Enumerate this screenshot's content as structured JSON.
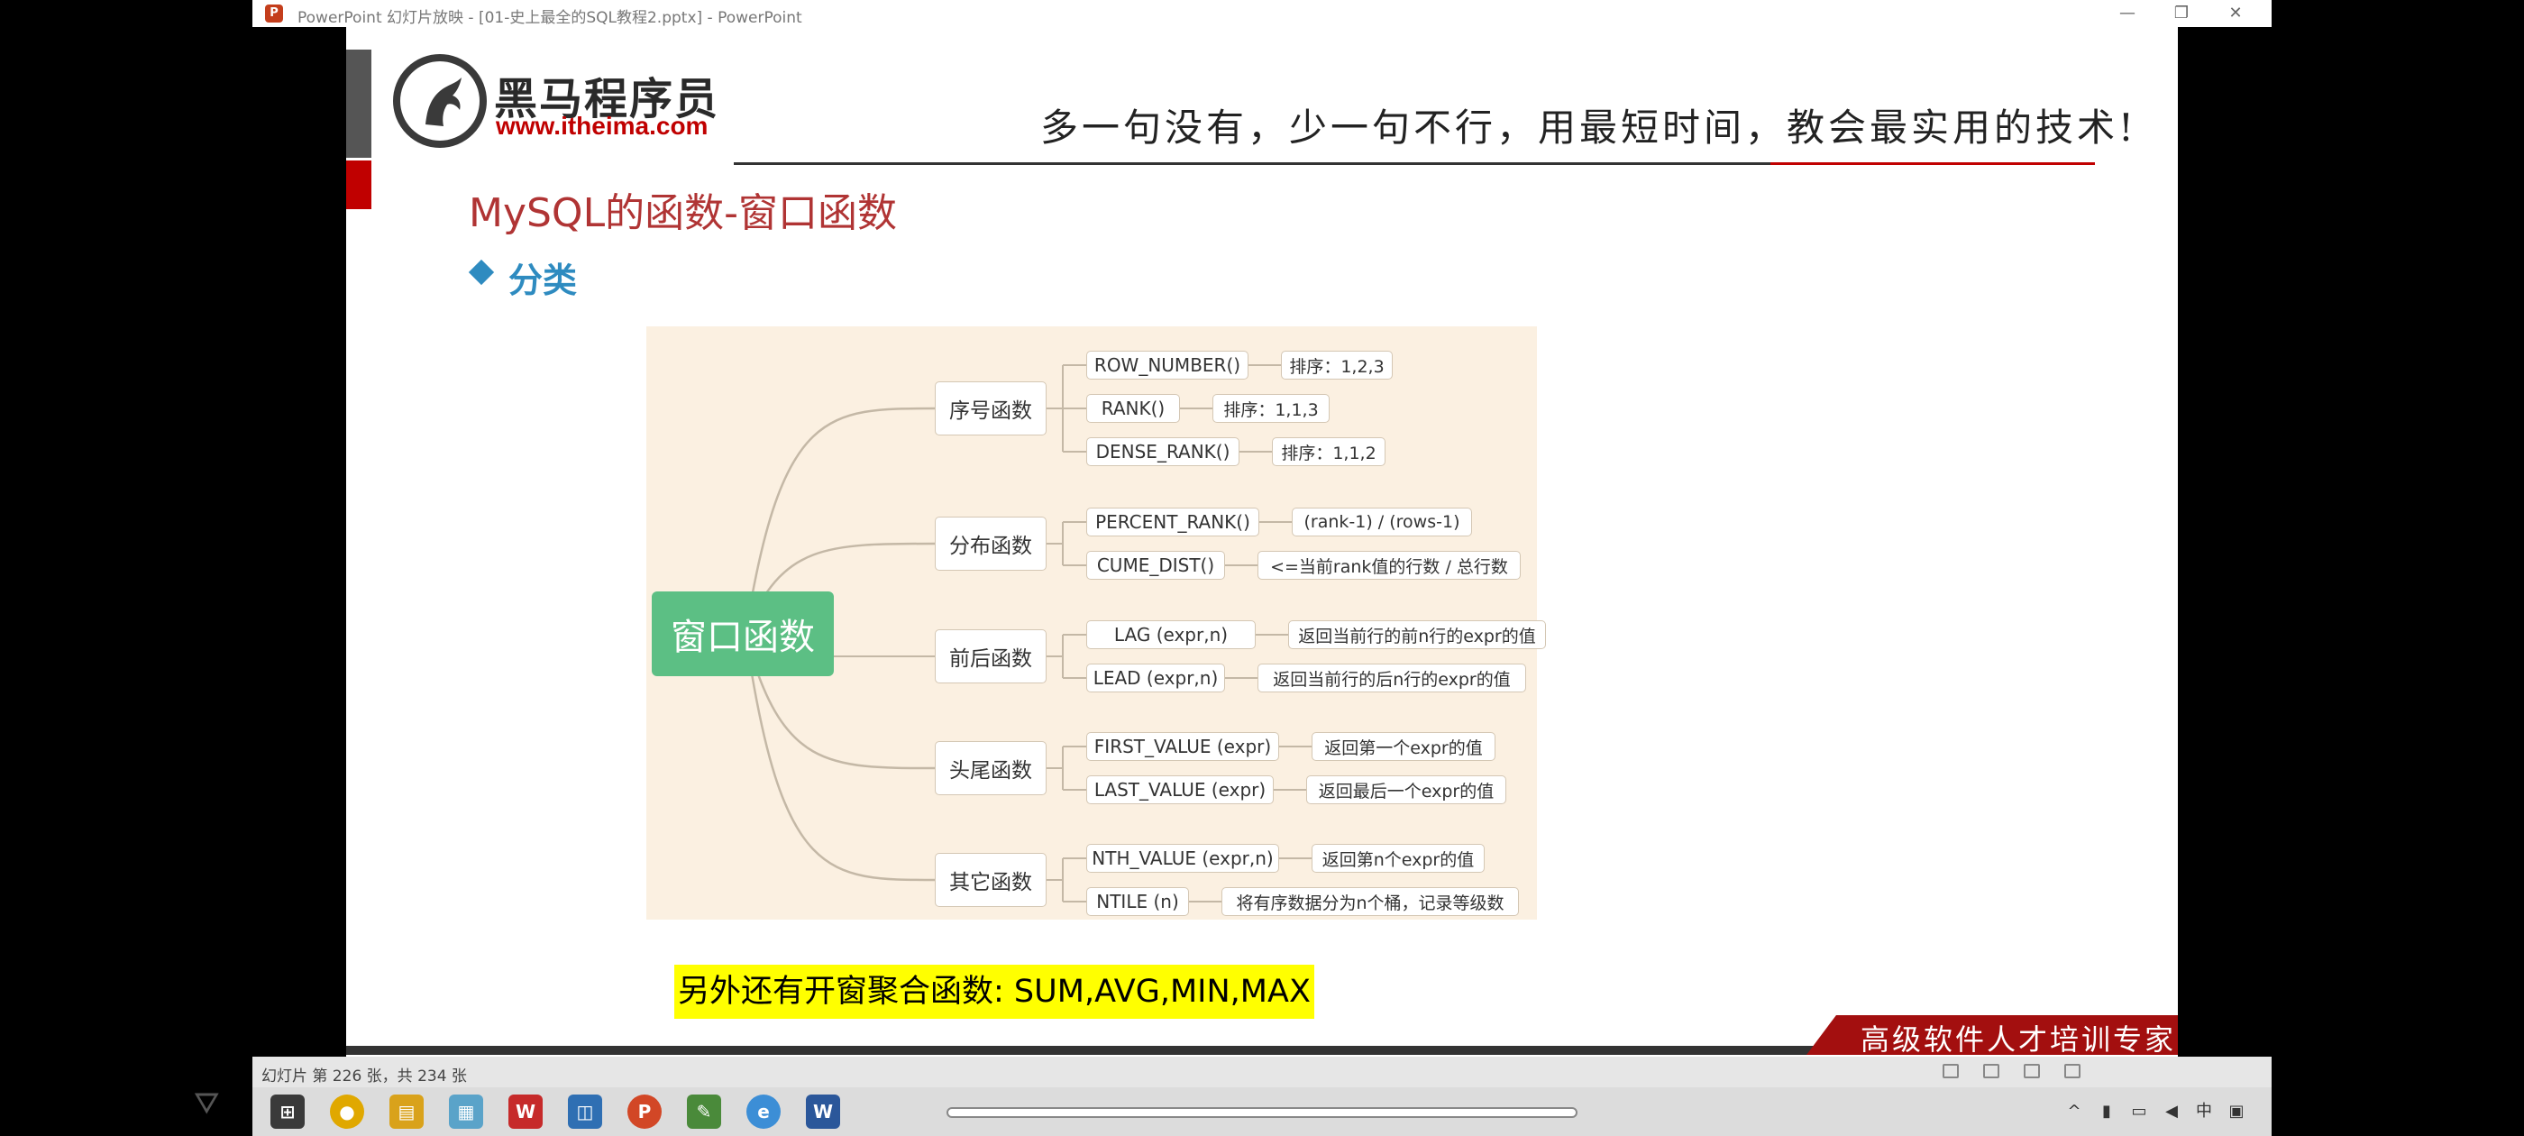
{
  "window": {
    "title": "PowerPoint 幻灯片放映 - [01-史上最全的SQL教程2.pptx] - PowerPoint",
    "app_icon": "P",
    "minimize": "—",
    "maximize": "❐",
    "close": "✕"
  },
  "slide": {
    "logo_name": "黑马程序员",
    "logo_url": "www.itheima.com",
    "slogan": "多一句没有，少一句不行，用最短时间，教会最实用的技术!",
    "title": "MySQL的函数-窗口函数",
    "bullet": "分类",
    "mindmap": {
      "root": "窗口函数",
      "categories": [
        {
          "label": "序号函数",
          "items": [
            {
              "name": "ROW_NUMBER()",
              "desc": "排序：1,2,3"
            },
            {
              "name": "RANK()",
              "desc": "排序：1,1,3"
            },
            {
              "name": "DENSE_RANK()",
              "desc": "排序：1,1,2"
            }
          ]
        },
        {
          "label": "分布函数",
          "items": [
            {
              "name": "PERCENT_RANK()",
              "desc": "(rank-1) / (rows-1)"
            },
            {
              "name": "CUME_DIST()",
              "desc": "<=当前rank值的行数 / 总行数"
            }
          ]
        },
        {
          "label": "前后函数",
          "items": [
            {
              "name": "LAG (expr,n)",
              "desc": "返回当前行的前n行的expr的值"
            },
            {
              "name": "LEAD (expr,n)",
              "desc": "返回当前行的后n行的expr的值"
            }
          ]
        },
        {
          "label": "头尾函数",
          "items": [
            {
              "name": "FIRST_VALUE (expr)",
              "desc": "返回第一个expr的值"
            },
            {
              "name": "LAST_VALUE (expr)",
              "desc": "返回最后一个expr的值"
            }
          ]
        },
        {
          "label": "其它函数",
          "items": [
            {
              "name": "NTH_VALUE (expr,n)",
              "desc": "返回第n个expr的值"
            },
            {
              "name": "NTILE (n)",
              "desc": "将有序数据分为n个桶，记录等级数"
            }
          ]
        }
      ]
    },
    "note": "另外还有开窗聚合函数: SUM,AVG,MIN,MAX",
    "banner": "高级软件人才培训专家"
  },
  "statusbar": {
    "slide_counter": "幻灯片 第 226 张，共 234 张"
  },
  "taskbar": {
    "apps": [
      "windows-start-icon",
      "chrome-icon",
      "file-explorer-icon",
      "notepad-icon",
      "wps-icon",
      "network-app-icon",
      "powerpoint-icon",
      "photo-editor-icon",
      "edge-icon",
      "word-icon"
    ]
  },
  "colors": {
    "title_red": "#b03434",
    "bullet_blue": "#2e8bc0",
    "root_green": "#5cbf84",
    "map_bg": "#fbf0e1",
    "highlight": "#ffff00"
  }
}
